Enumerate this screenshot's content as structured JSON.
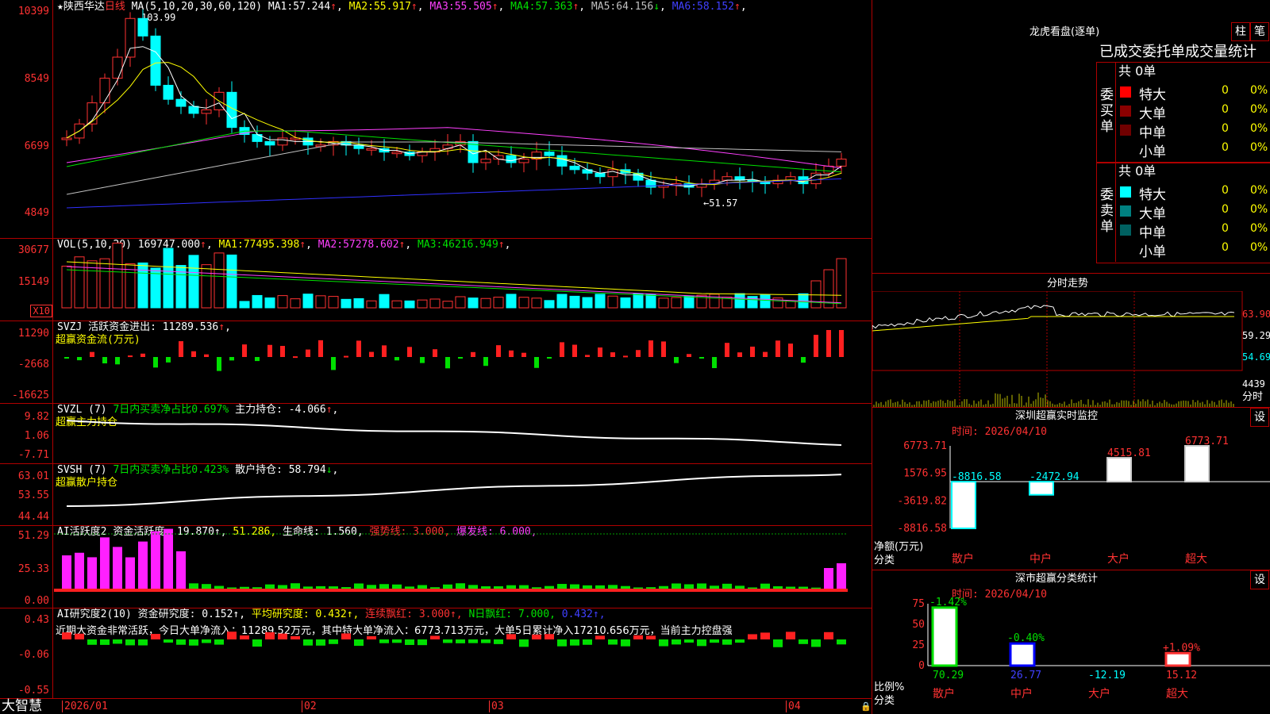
{
  "header": {
    "stock_name": "★陕西华达",
    "period": "日线",
    "ma_params": "MA(5,10,20,30,60,120)",
    "ma_values": [
      {
        "label": "MA1:",
        "value": "57.244",
        "arrow": "↑",
        "color": "#ffffff"
      },
      {
        "label": "MA2:",
        "value": "55.917",
        "arrow": "↑",
        "color": "#ffff00"
      },
      {
        "label": "MA3:",
        "value": "55.505",
        "arrow": "↑",
        "color": "#ff40ff"
      },
      {
        "label": "MA4:",
        "value": "57.363",
        "arrow": "↑",
        "color": "#00e000"
      },
      {
        "label": "MA5:",
        "value": "64.156",
        "arrow": "↓",
        "color": "#c0c0c0"
      },
      {
        "label": "MA6:",
        "value": "58.152",
        "arrow": "↑",
        "color": "#4040ff"
      }
    ]
  },
  "price_panel": {
    "y_ticks": [
      "10399",
      "8549",
      "6699",
      "4849"
    ],
    "high_marker": "103.99",
    "low_marker": "←51.57"
  },
  "vol_panel": {
    "title": "VOL(5,10,20)",
    "value": "169747.000",
    "items": [
      {
        "label": "MA1:",
        "value": "77495.398",
        "color": "#ffff00"
      },
      {
        "label": "MA2:",
        "value": "57278.602",
        "color": "#ff40ff"
      },
      {
        "label": "MA3:",
        "value": "46216.949",
        "color": "#00e000"
      }
    ],
    "y_ticks": [
      "30677",
      "15149"
    ],
    "unit": "X10"
  },
  "svzj_panel": {
    "title": "SVZJ",
    "label": "活跃资金进出:",
    "value": "11289.536",
    "subtitle": "超赢资金流(万元)",
    "y_ticks": [
      "11290",
      "-2668",
      "-16625"
    ]
  },
  "svzl_panel": {
    "title": "SVZL (7)",
    "ratio_text": "7日内买卖净占比0.697%",
    "label": "主力持仓:",
    "value": "-4.066",
    "subtitle": "超赢主力持仓",
    "y_ticks": [
      "9.82",
      "1.06",
      "-7.71"
    ]
  },
  "svsh_panel": {
    "title": "SVSH (7)",
    "ratio_text": "7日内买卖净占比0.423%",
    "label": "散户持仓:",
    "value": "58.794",
    "subtitle": "超赢散户持仓",
    "y_ticks": [
      "63.01",
      "53.55",
      "44.44"
    ]
  },
  "ai_active_panel": {
    "title": "AI活跃度2",
    "items": [
      {
        "text": "资金活跃度: 19.870↑,",
        "color": "#ffffff"
      },
      {
        "text": "51.286,",
        "color": "#ffff00"
      },
      {
        "text": "生命线: 1.560,",
        "color": "#ffffff"
      },
      {
        "text": "强势线: 3.000,",
        "color": "#ff3232"
      },
      {
        "text": "爆发线: 6.000,",
        "color": "#ff40ff"
      }
    ],
    "y_ticks": [
      "51.29",
      "25.33",
      "0.00"
    ]
  },
  "ai_research_panel": {
    "title": "AI研究度2(10)",
    "items": [
      {
        "text": "资金研究度: 0.152↑,",
        "color": "#ffffff"
      },
      {
        "text": "平均研究度: 0.432↑,",
        "color": "#ffff00"
      },
      {
        "text": "连续飘红: 3.000↑,",
        "color": "#ff3232"
      },
      {
        "text": "N日飘红: 7.000,",
        "color": "#00e000"
      },
      {
        "text": "0.432↑,",
        "color": "#4040ff"
      }
    ],
    "comment": "近期大资金非常活跃，今日大单净流入：11289.52万元，其中特大单净流入：6773.713万元，大单5日累计净入17210.656万元，当前主力控盘强",
    "y_ticks": [
      "0.43",
      "-0.06",
      "-0.55"
    ]
  },
  "x_axis": {
    "labels": [
      "2026/01",
      "02",
      "03",
      "04"
    ],
    "brand": "大智慧"
  },
  "dragon_tiger": {
    "title": "龙虎看盘(逐单)",
    "btn_bar": "柱",
    "btn_pen": "笔",
    "tabs": "已成交委托单成交量统计",
    "buy": {
      "side_label": "委买单",
      "total": "共 0单",
      "rows": [
        {
          "name": "特大",
          "count": "0",
          "pct": "0%",
          "color": "#ff0000"
        },
        {
          "name": "大单",
          "count": "0",
          "pct": "0%",
          "color": "#8b0000"
        },
        {
          "name": "中单",
          "count": "0",
          "pct": "0%",
          "color": "#700000"
        },
        {
          "name": "小单",
          "count": "0",
          "pct": "0%",
          "color": ""
        }
      ]
    },
    "sell": {
      "side_label": "委卖单",
      "total": "共 0单",
      "rows": [
        {
          "name": "特大",
          "count": "0",
          "pct": "0%",
          "color": "#00ffff"
        },
        {
          "name": "大单",
          "count": "0",
          "pct": "0%",
          "color": "#008080"
        },
        {
          "name": "中单",
          "count": "0",
          "pct": "0%",
          "color": "#006060"
        },
        {
          "name": "小单",
          "count": "0",
          "pct": "0%",
          "color": ""
        }
      ]
    }
  },
  "intraday": {
    "title": "分时走势",
    "price_ticks": [
      "63.90",
      "59.29",
      "54.69"
    ],
    "vol_tick": "4439",
    "vol_label": "分时"
  },
  "sz_monitor": {
    "title": "深圳超赢实时监控",
    "settings": "设",
    "time": "时间: 2026/04/10",
    "y_ticks": [
      "6773.71",
      "1576.95",
      "-3619.82",
      "-8816.58"
    ],
    "ylabel": "净额(万元)",
    "xlabel": "分类",
    "chart_data": {
      "type": "bar",
      "categories": [
        "散户",
        "中户",
        "大户",
        "超大"
      ],
      "values": [
        -8816.58,
        -2472.94,
        4515.81,
        6773.71
      ],
      "value_labels": [
        "-8816.58",
        "-2472.94",
        "4515.81",
        "6773.71"
      ],
      "ylim": [
        -8816.58,
        6773.71
      ]
    }
  },
  "sz_category": {
    "title": "深市超赢分类统计",
    "settings": "设",
    "time": "时间: 2026/04/10",
    "y_ticks": [
      "75",
      "50",
      "25",
      "0"
    ],
    "ylabel": "比例%",
    "xlabel": "分类",
    "chart_data": {
      "type": "bar",
      "categories": [
        "散户",
        "中户",
        "大户",
        "超大"
      ],
      "values": [
        70.29,
        26.77,
        -12.19,
        15.12
      ],
      "top_labels": [
        "-1.42%",
        "-0.40%",
        "",
        "+1.09%"
      ],
      "bottom_labels": [
        "70.29",
        "26.77",
        "-12.19",
        "15.12"
      ],
      "ylim": [
        0,
        75
      ]
    }
  }
}
